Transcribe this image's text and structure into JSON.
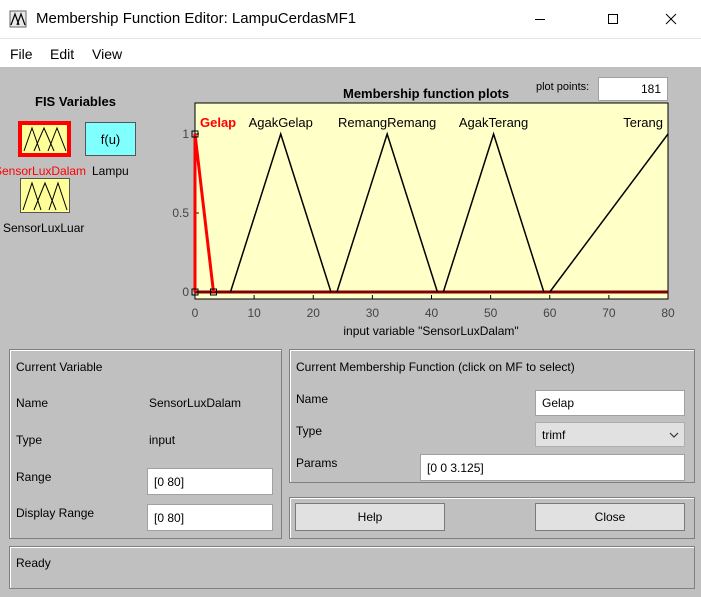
{
  "window": {
    "title": "Membership Function Editor: LampuCerdasMF1"
  },
  "menu": {
    "file": "File",
    "edit": "Edit",
    "view": "View"
  },
  "fis": {
    "title": "FIS Variables",
    "inputs": [
      {
        "label": "SensorLuxDalam"
      },
      {
        "label": "SensorLuxLuar"
      }
    ],
    "output": {
      "symbol": "f(u)",
      "label": "Lampu"
    }
  },
  "plot": {
    "title": "Membership function plots",
    "points_label": "plot points:",
    "points_value": "181",
    "xlabel": "input variable \"SensorLuxDalam\""
  },
  "chart_data": {
    "type": "line",
    "xlim": [
      0,
      80
    ],
    "ylim": [
      0,
      1
    ],
    "xticks": [
      "0",
      "10",
      "20",
      "30",
      "40",
      "50",
      "60",
      "70",
      "80"
    ],
    "yticks": [
      "0",
      "0.5",
      "1"
    ],
    "series": [
      {
        "name": "Gelap",
        "x": [
          0,
          0,
          3.125
        ],
        "y": [
          0,
          1,
          0
        ],
        "color": "#ff0000"
      },
      {
        "name": "AgakGelap",
        "x": [
          6,
          14.5,
          23
        ],
        "y": [
          0,
          1,
          0
        ],
        "color": "#000000"
      },
      {
        "name": "RemangRemang",
        "x": [
          24,
          32.5,
          41
        ],
        "y": [
          0,
          1,
          0
        ],
        "color": "#000000"
      },
      {
        "name": "AgakTerang",
        "x": [
          42,
          50.5,
          59
        ],
        "y": [
          0,
          1,
          0
        ],
        "color": "#000000"
      },
      {
        "name": "Terang",
        "x": [
          60,
          80,
          80
        ],
        "y": [
          0,
          1,
          1
        ],
        "color": "#000000"
      }
    ]
  },
  "current_variable": {
    "title": "Current Variable",
    "name_label": "Name",
    "name_value": "SensorLuxDalam",
    "type_label": "Type",
    "type_value": "input",
    "range_label": "Range",
    "range_value": "[0 80]",
    "display_range_label": "Display Range",
    "display_range_value": "[0 80]"
  },
  "current_mf": {
    "title": "Current Membership Function (click on MF to select)",
    "name_label": "Name",
    "name_value": "Gelap",
    "type_label": "Type",
    "type_value": "trimf",
    "params_label": "Params",
    "params_value": "[0 0 3.125]"
  },
  "buttons": {
    "help": "Help",
    "close": "Close"
  },
  "status": "Ready"
}
